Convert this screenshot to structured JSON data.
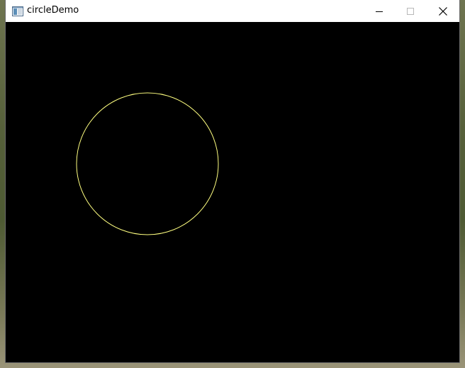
{
  "window": {
    "title": "circleDemo"
  },
  "canvas": {
    "background_color": "#000000",
    "circle": {
      "stroke_color": "#ffff80"
    }
  }
}
